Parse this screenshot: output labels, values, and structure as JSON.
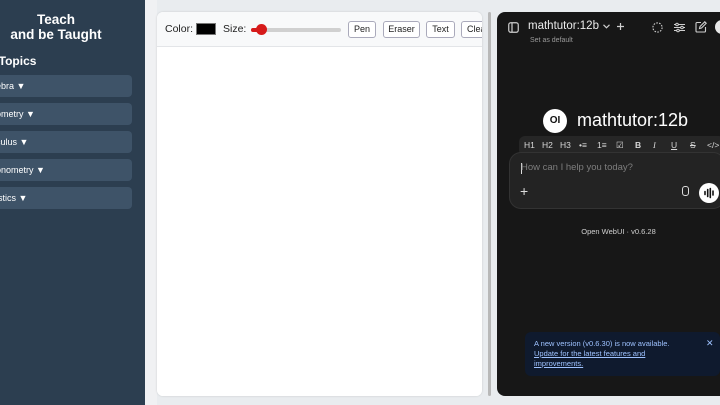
{
  "sidebar": {
    "title_line1": "Teach",
    "title_line2": "and be Taught",
    "topics_heading": "h Topics",
    "topics": [
      "ebra ▼",
      "ometry ▼",
      "culus ▼",
      "onometry ▼",
      "istics ▼"
    ]
  },
  "toolbar": {
    "color_label": "Color:",
    "color_value": "#000000",
    "size_label": "Size:",
    "size_fraction": 0.12,
    "buttons": [
      "Pen",
      "Eraser",
      "Text",
      "Clea"
    ]
  },
  "chat": {
    "model_name": "mathtutor:12b",
    "set_default": "Set as default",
    "brand_logo": "OI",
    "brand_name": "mathtutor:12b",
    "format_buttons": [
      "H1",
      "H2",
      "H3",
      "•≡",
      "1≡",
      "☑",
      "B",
      "I",
      "U",
      "S",
      "</>"
    ],
    "input_placeholder": "How can I help you today?",
    "footer": "Open WebUI · v0.6.28",
    "toast_message": "A new version (v0.6.30) is now available.",
    "toast_link": "Update for the latest features and improvements.",
    "accent": "#9ec2ff"
  }
}
